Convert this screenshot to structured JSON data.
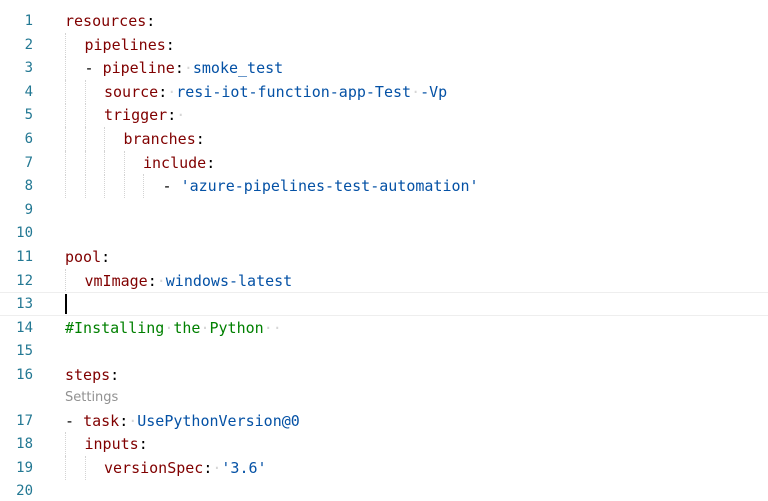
{
  "editor": {
    "codelens_settings": "Settings",
    "lines": [
      {
        "num": "1",
        "indent": 0,
        "tokens": [
          [
            "k",
            "resources"
          ],
          [
            "p",
            ":"
          ]
        ]
      },
      {
        "num": "2",
        "indent": 1,
        "tokens": [
          [
            "k",
            "pipelines"
          ],
          [
            "p",
            ":"
          ]
        ]
      },
      {
        "num": "3",
        "indent": 1,
        "tokens": [
          [
            "p",
            "- "
          ],
          [
            "k",
            "pipeline"
          ],
          [
            "p",
            ":"
          ],
          [
            "ws",
            "·"
          ],
          [
            "v",
            "smoke_test"
          ]
        ]
      },
      {
        "num": "4",
        "indent": 2,
        "tokens": [
          [
            "k",
            "source"
          ],
          [
            "p",
            ":"
          ],
          [
            "ws",
            "·"
          ],
          [
            "v",
            "resi-iot-function-app-Test"
          ],
          [
            "ws",
            "·"
          ],
          [
            "v",
            "-Vp"
          ]
        ]
      },
      {
        "num": "5",
        "indent": 2,
        "tokens": [
          [
            "k",
            "trigger"
          ],
          [
            "p",
            ":"
          ],
          [
            "ws",
            "·"
          ]
        ]
      },
      {
        "num": "6",
        "indent": 3,
        "tokens": [
          [
            "k",
            "branches"
          ],
          [
            "p",
            ":"
          ]
        ]
      },
      {
        "num": "7",
        "indent": 4,
        "tokens": [
          [
            "k",
            "include"
          ],
          [
            "p",
            ":"
          ]
        ]
      },
      {
        "num": "8",
        "indent": 5,
        "tokens": [
          [
            "p",
            "- "
          ],
          [
            "v",
            "'azure-pipelines-test-automation'"
          ]
        ]
      },
      {
        "num": "9",
        "indent": 0,
        "tokens": []
      },
      {
        "num": "10",
        "indent": 0,
        "tokens": []
      },
      {
        "num": "11",
        "indent": 0,
        "tokens": [
          [
            "k",
            "pool"
          ],
          [
            "p",
            ":"
          ]
        ]
      },
      {
        "num": "12",
        "indent": 1,
        "tokens": [
          [
            "k",
            "vmImage"
          ],
          [
            "p",
            ":"
          ],
          [
            "ws",
            "·"
          ],
          [
            "v",
            "windows-latest"
          ]
        ]
      },
      {
        "num": "13",
        "indent": 0,
        "tokens": [],
        "current": true
      },
      {
        "num": "14",
        "indent": 0,
        "tokens": [
          [
            "c",
            "#Installing"
          ],
          [
            "ws",
            "·"
          ],
          [
            "c",
            "the"
          ],
          [
            "ws",
            "·"
          ],
          [
            "c",
            "Python"
          ],
          [
            "ws",
            "··"
          ]
        ]
      },
      {
        "num": "15",
        "indent": 0,
        "tokens": []
      },
      {
        "num": "16",
        "indent": 0,
        "tokens": [
          [
            "k",
            "steps"
          ],
          [
            "p",
            ":"
          ]
        ],
        "codelens_after": true
      },
      {
        "num": "17",
        "indent": 0,
        "tokens": [
          [
            "p",
            "- "
          ],
          [
            "k",
            "task"
          ],
          [
            "p",
            ":"
          ],
          [
            "ws",
            "·"
          ],
          [
            "v",
            "UsePythonVersion@0"
          ]
        ]
      },
      {
        "num": "18",
        "indent": 1,
        "tokens": [
          [
            "k",
            "inputs"
          ],
          [
            "p",
            ":"
          ]
        ]
      },
      {
        "num": "19",
        "indent": 2,
        "tokens": [
          [
            "k",
            "versionSpec"
          ],
          [
            "p",
            ":"
          ],
          [
            "ws",
            "·"
          ],
          [
            "v",
            "'3.6'"
          ]
        ]
      },
      {
        "num": "20",
        "indent": 0,
        "tokens": []
      }
    ]
  }
}
